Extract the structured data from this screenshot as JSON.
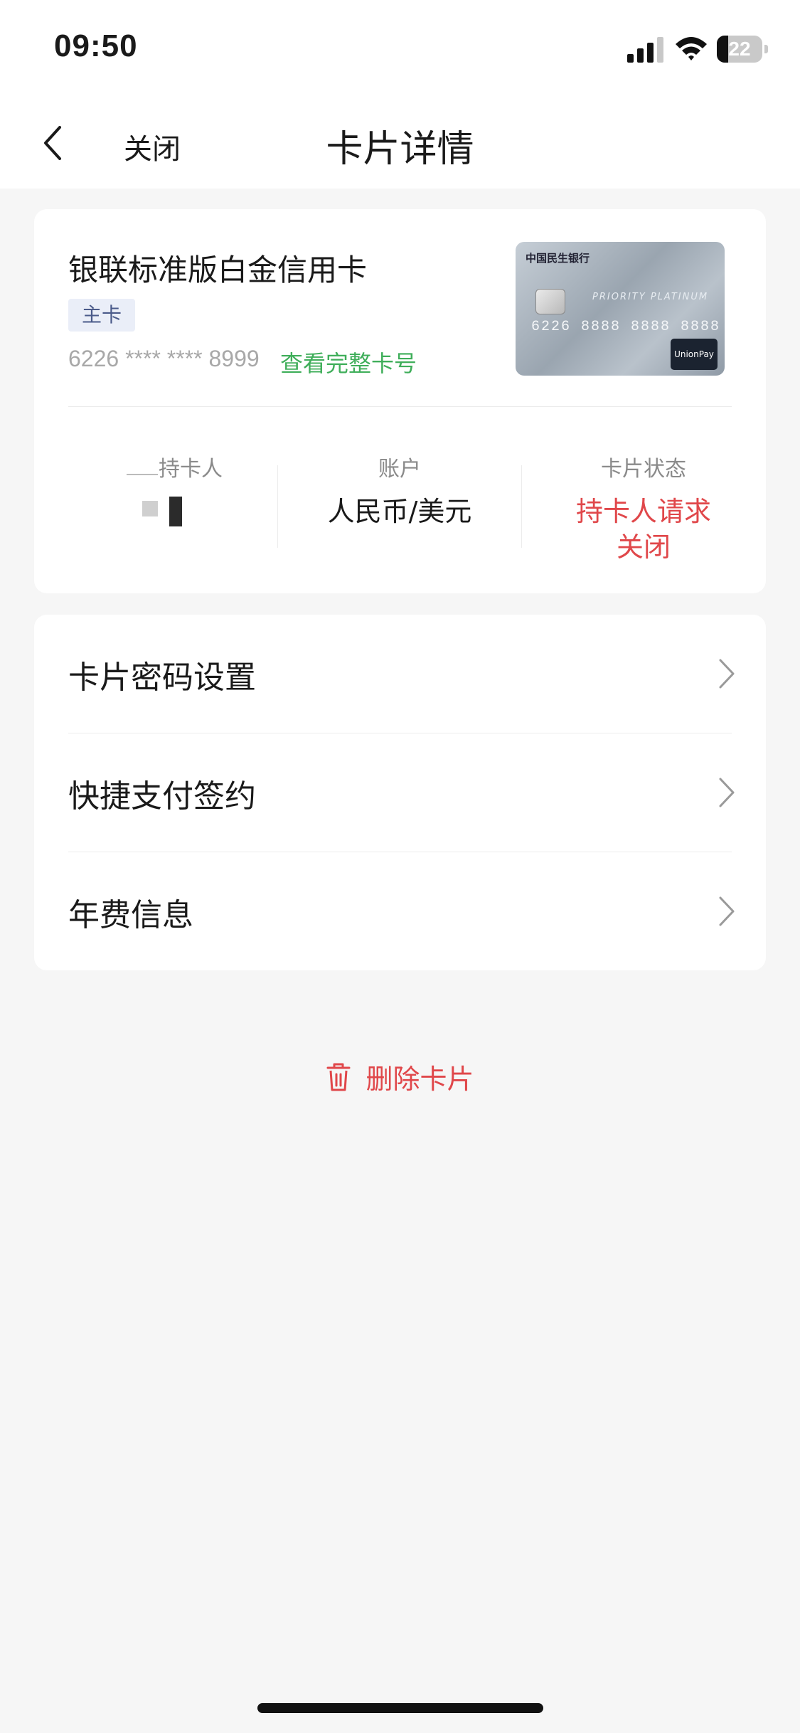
{
  "status_bar": {
    "time": "09:50",
    "battery": "22"
  },
  "nav": {
    "close_label": "关闭",
    "title": "卡片详情"
  },
  "card": {
    "name": "银联标准版白金信用卡",
    "tag": "主卡",
    "number_masked": "6226 **** **** 8999",
    "view_full_link": "查看完整卡号",
    "image": {
      "bank_name": "中国民生银行",
      "tier": "PRIORITY PLATINUM",
      "number": "6226 8888 8888 8888",
      "network": "UnionPay 银联"
    },
    "info": {
      "holder": {
        "label": "持卡人"
      },
      "account": {
        "label": "账户",
        "value": "人民币/美元"
      },
      "status": {
        "label": "卡片状态",
        "value": "持卡人请求关闭"
      }
    }
  },
  "menu": {
    "items": [
      {
        "label": "卡片密码设置"
      },
      {
        "label": "快捷支付签约"
      },
      {
        "label": "年费信息"
      }
    ]
  },
  "actions": {
    "delete_label": "删除卡片"
  },
  "colors": {
    "accent_red": "#e0474a",
    "link_green": "#3fae5a",
    "background": "#f6f6f6"
  }
}
